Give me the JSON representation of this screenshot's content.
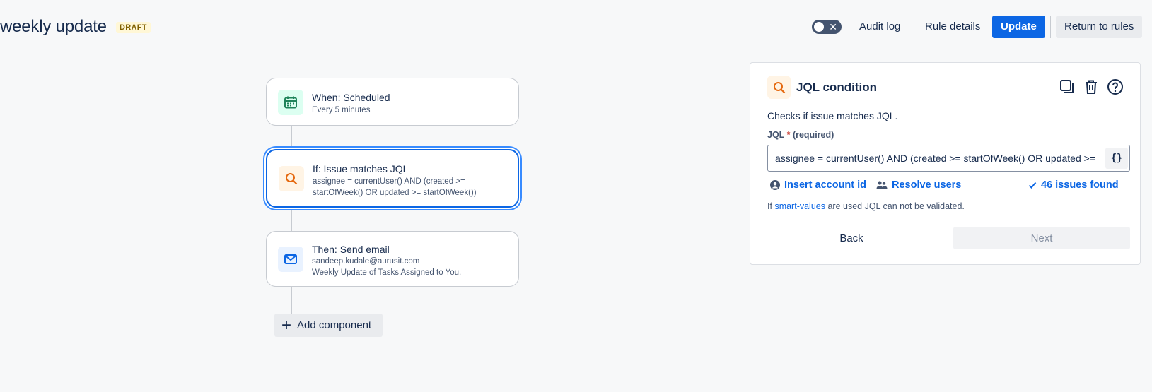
{
  "header": {
    "title": "weekly update",
    "status_badge": "DRAFT",
    "toggle": {
      "enabled": false,
      "icon": "close-icon"
    },
    "audit_log_label": "Audit log",
    "rule_details_label": "Rule details",
    "update_label": "Update",
    "return_label": "Return to rules"
  },
  "flow": {
    "nodes": [
      {
        "title": "When: Scheduled",
        "subtitle": "Every 5 minutes",
        "icon": "calendar-icon",
        "selected": false
      },
      {
        "title": "If: Issue matches JQL",
        "subtitle": "assignee = currentUser() AND (created >= startOfWeek() OR updated >= startOfWeek())",
        "icon": "search-icon",
        "selected": true
      },
      {
        "title": "Then: Send email",
        "subtitle_line1": "sandeep.kudale@aurusit.com",
        "subtitle_line2": "Weekly Update of Tasks Assigned to You.",
        "icon": "mail-icon",
        "selected": false
      }
    ],
    "add_component_label": "Add component"
  },
  "panel": {
    "title": "JQL condition",
    "icon": "search-icon",
    "tools": [
      "duplicate-icon",
      "trash-icon",
      "help-icon"
    ],
    "description": "Checks if issue matches JQL.",
    "field_label": "JQL",
    "required_mark": "*",
    "required_text": "(required)",
    "jql_value": "assignee = currentUser() AND (created >= startOfWeek() OR updated >= startOfWeek())",
    "smart_value_button": "{}",
    "insert_account_label": "Insert account id",
    "resolve_users_label": "Resolve users",
    "issues_found_label": "46 issues found",
    "note_prefix": "If",
    "note_link": "smart-values",
    "note_suffix": "are used JQL can not be validated.",
    "back_label": "Back",
    "next_label": "Next"
  },
  "colors": {
    "accent": "#0c66e4",
    "calendar": "#1f845a",
    "search": "#e56910",
    "mail": "#0c66e4"
  }
}
